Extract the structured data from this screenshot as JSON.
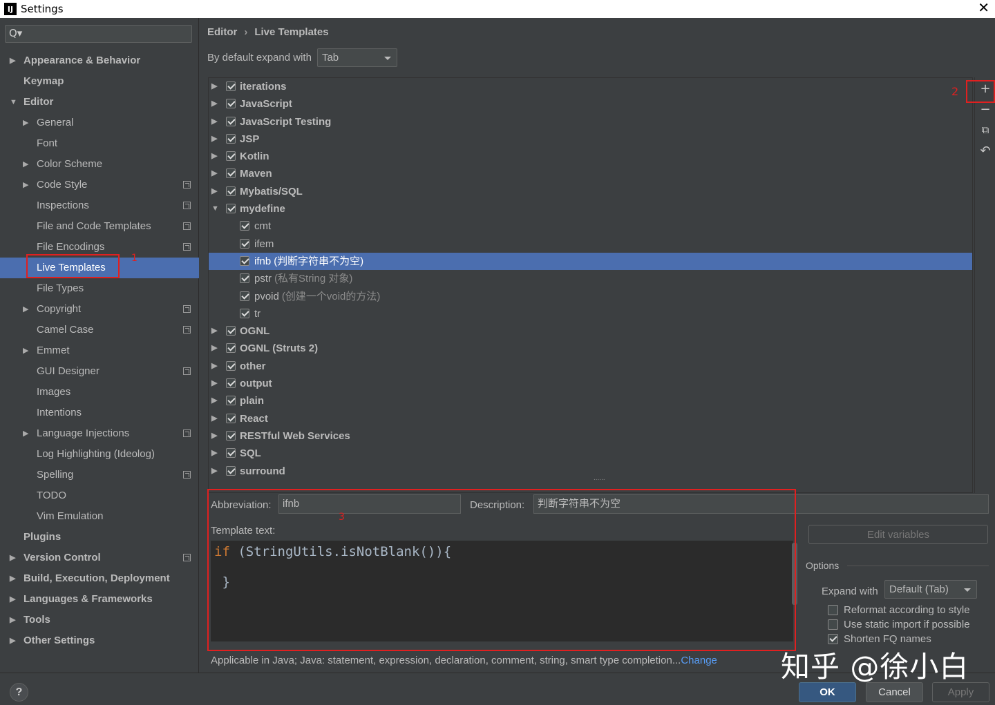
{
  "window": {
    "title": "Settings",
    "app_badge": "IJ",
    "close_glyph": "✕"
  },
  "search": {
    "icon": "Q▾",
    "value": ""
  },
  "sidebar": {
    "items": [
      {
        "label": "Appearance & Behavior",
        "level": 0,
        "bold": true,
        "expander": "collapsed"
      },
      {
        "label": "Keymap",
        "level": 0,
        "bold": true
      },
      {
        "label": "Editor",
        "level": 0,
        "bold": true,
        "expander": "expanded"
      },
      {
        "label": "General",
        "level": 1,
        "expander": "collapsed"
      },
      {
        "label": "Font",
        "level": 1
      },
      {
        "label": "Color Scheme",
        "level": 1,
        "expander": "collapsed"
      },
      {
        "label": "Code Style",
        "level": 1,
        "expander": "collapsed",
        "project_icon": true
      },
      {
        "label": "Inspections",
        "level": 1,
        "project_icon": true
      },
      {
        "label": "File and Code Templates",
        "level": 1,
        "project_icon": true
      },
      {
        "label": "File Encodings",
        "level": 1,
        "project_icon": true
      },
      {
        "label": "Live Templates",
        "level": 1,
        "selected": true
      },
      {
        "label": "File Types",
        "level": 1
      },
      {
        "label": "Copyright",
        "level": 1,
        "expander": "collapsed",
        "project_icon": true
      },
      {
        "label": "Camel Case",
        "level": 1,
        "project_icon": true
      },
      {
        "label": "Emmet",
        "level": 1,
        "expander": "collapsed"
      },
      {
        "label": "GUI Designer",
        "level": 1,
        "project_icon": true
      },
      {
        "label": "Images",
        "level": 1
      },
      {
        "label": "Intentions",
        "level": 1
      },
      {
        "label": "Language Injections",
        "level": 1,
        "expander": "collapsed",
        "project_icon": true
      },
      {
        "label": "Log Highlighting (Ideolog)",
        "level": 1
      },
      {
        "label": "Spelling",
        "level": 1,
        "project_icon": true
      },
      {
        "label": "TODO",
        "level": 1
      },
      {
        "label": "Vim Emulation",
        "level": 1
      },
      {
        "label": "Plugins",
        "level": 0,
        "bold": true
      },
      {
        "label": "Version Control",
        "level": 0,
        "bold": true,
        "expander": "collapsed",
        "project_icon": true
      },
      {
        "label": "Build, Execution, Deployment",
        "level": 0,
        "bold": true,
        "expander": "collapsed"
      },
      {
        "label": "Languages & Frameworks",
        "level": 0,
        "bold": true,
        "expander": "collapsed"
      },
      {
        "label": "Tools",
        "level": 0,
        "bold": true,
        "expander": "collapsed"
      },
      {
        "label": "Other Settings",
        "level": 0,
        "bold": true,
        "expander": "collapsed"
      }
    ]
  },
  "annotations": {
    "mark1": "1",
    "mark2": "2",
    "mark3": "3",
    "color": "#e02020"
  },
  "breadcrumb": {
    "parent": "Editor",
    "separator": "›",
    "current": "Live Templates"
  },
  "expand_with": {
    "label": "By default expand with",
    "value": "Tab"
  },
  "templates": [
    {
      "name": "iterations",
      "group": true,
      "checked": true
    },
    {
      "name": "JavaScript",
      "group": true,
      "checked": true
    },
    {
      "name": "JavaScript Testing",
      "group": true,
      "checked": true
    },
    {
      "name": "JSP",
      "group": true,
      "checked": true
    },
    {
      "name": "Kotlin",
      "group": true,
      "checked": true
    },
    {
      "name": "Maven",
      "group": true,
      "checked": true
    },
    {
      "name": "Mybatis/SQL",
      "group": true,
      "checked": true
    },
    {
      "name": "mydefine",
      "group": true,
      "checked": true,
      "expanded": true
    },
    {
      "name": "cmt",
      "group": false,
      "checked": true,
      "desc": ""
    },
    {
      "name": "ifem",
      "group": false,
      "checked": true,
      "desc": ""
    },
    {
      "name": "ifnb",
      "group": false,
      "checked": true,
      "desc": "(判断字符串不为空)",
      "selected": true
    },
    {
      "name": "pstr",
      "group": false,
      "checked": true,
      "desc": "(私有String 对象)"
    },
    {
      "name": "pvoid",
      "group": false,
      "checked": true,
      "desc": "(创建一个void的方法)"
    },
    {
      "name": "tr",
      "group": false,
      "checked": true,
      "desc": ""
    },
    {
      "name": "OGNL",
      "group": true,
      "checked": true
    },
    {
      "name": "OGNL (Struts 2)",
      "group": true,
      "checked": true
    },
    {
      "name": "other",
      "group": true,
      "checked": true
    },
    {
      "name": "output",
      "group": true,
      "checked": true
    },
    {
      "name": "plain",
      "group": true,
      "checked": true
    },
    {
      "name": "React",
      "group": true,
      "checked": true
    },
    {
      "name": "RESTful Web Services",
      "group": true,
      "checked": true
    },
    {
      "name": "SQL",
      "group": true,
      "checked": true
    },
    {
      "name": "surround",
      "group": true,
      "checked": true
    }
  ],
  "side_tools": {
    "add": "+",
    "remove": "−",
    "copy": "⧉",
    "restore": "↶"
  },
  "editor": {
    "abbreviation_label": "Abbreviation:",
    "abbreviation_value": "ifnb",
    "description_label": "Description:",
    "description_value": "判断字符串不为空",
    "template_text_label": "Template text:",
    "code_keyword": "if",
    "code_line1_rest": " (StringUtils.isNotBlank()){",
    "code_line3": " }",
    "edit_variables": "Edit variables",
    "options_label": "Options",
    "expand_with_label": "Expand with",
    "expand_with_value": "Default (Tab)",
    "reformat": "Reformat according to style",
    "static_import": "Use static import if possible",
    "shorten_fq": "Shorten FQ names",
    "applicable_text": "Applicable in Java; Java: statement, expression, declaration, comment, string, smart type completion...",
    "change_link": "Change"
  },
  "buttons": {
    "help": "?",
    "ok": "OK",
    "cancel": "Cancel",
    "apply": "Apply"
  },
  "watermark": "知乎 @徐小白"
}
